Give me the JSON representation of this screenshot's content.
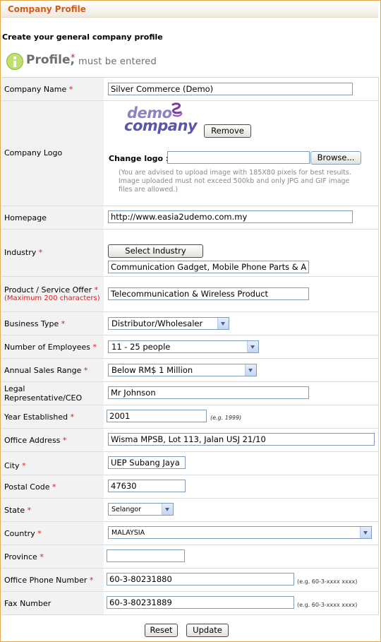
{
  "header": {
    "title": "Company Profile"
  },
  "subtitle": "Create your general company profile",
  "profile_note": {
    "word": "Profile,",
    "star": "*",
    "text": "must be entered"
  },
  "form": {
    "company_name": {
      "label": "Company Name",
      "star": "*",
      "value": "Silver Commerce (Demo)"
    },
    "company_logo": {
      "label": "Company Logo",
      "logo_line1": "demo",
      "logo_line2": "company",
      "remove_label": "Remove",
      "change_label": "Change logo :",
      "browse_label": "Browse...",
      "advice": "(You are advised to upload image with 185X80 pixels for best results. Image uploaded must not exceed 500kb and only JPG and GIF image files are allowed.)"
    },
    "homepage": {
      "label": "Homepage",
      "value": "http://www.easia2udemo.com.my"
    },
    "industry": {
      "label": "Industry",
      "star": "*",
      "button_label": "Select Industry",
      "value": "Communication Gadget, Mobile Phone Parts & A"
    },
    "product_offer": {
      "label": "Product / Service  Offer",
      "star": "*",
      "note": "(Maximum 200 characters)",
      "value": "Telecommunication & Wireless Product"
    },
    "business_type": {
      "label": "Business Type",
      "star": "*",
      "value": "Distributor/Wholesaler"
    },
    "employees": {
      "label": "Number of  Employees",
      "star": "*",
      "value": "11 - 25 people"
    },
    "sales_range": {
      "label": "Annual Sales Range",
      "star": "*",
      "value": "Below RM$ 1 Million"
    },
    "legal_rep": {
      "label_line1": "Legal",
      "label_line2": "Representative/CEO",
      "value": "Mr Johnson"
    },
    "year_established": {
      "label": "Year Established",
      "star": "*",
      "value": "2001",
      "hint": "(e.g. 1999)"
    },
    "office_address": {
      "label": "Office Address",
      "star": "*",
      "value": "Wisma MPSB, Lot 113, Jalan USJ 21/10"
    },
    "city": {
      "label": "City",
      "star": "*",
      "value": "UEP Subang Jaya"
    },
    "postal_code": {
      "label": "Postal Code",
      "star": "*",
      "value": "47630"
    },
    "state": {
      "label": "State",
      "star": "*",
      "value": "Selangor"
    },
    "country": {
      "label": "Country",
      "star": "*",
      "value": "MALAYSIA"
    },
    "province": {
      "label": "Province",
      "star": "*",
      "value": ""
    },
    "office_phone": {
      "label": "Office Phone Number",
      "star": "*",
      "value": "60-3-80231880",
      "hint": "(e.g. 60-3-xxxx xxxx)"
    },
    "fax": {
      "label": "Fax Number",
      "value": "60-3-80231889",
      "hint": "(e.g. 60-3-xxxx xxxx)"
    }
  },
  "actions": {
    "reset_label": "Reset",
    "update_label": "Update"
  }
}
